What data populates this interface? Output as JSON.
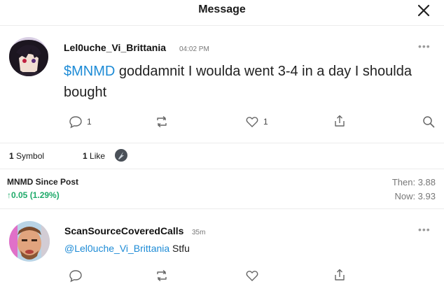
{
  "header": {
    "title": "Message"
  },
  "post": {
    "username": "Lel0uche_Vi_Brittania",
    "time": "04:02 PM",
    "cashtag": "$MNMD",
    "text": " goddamnit I woulda went 3-4 in a day I shoulda bought",
    "reply_count": "1",
    "like_count": "1"
  },
  "stats": {
    "symbols": "1",
    "symbols_label": "Symbol",
    "likes": "1",
    "likes_label": "Like"
  },
  "since_post": {
    "title": "MNMD Since Post",
    "change": "0.05 (1.29%)",
    "then": "Then: 3.88",
    "now": "Now: 3.93"
  },
  "reply": {
    "username": "ScanSourceCoveredCalls",
    "time": "35m",
    "mention": "@Lel0uche_Vi_Brittania",
    "text": " Stfu"
  },
  "colors": {
    "cashtag": "#1d8bd6",
    "positive": "#1faa6a"
  }
}
